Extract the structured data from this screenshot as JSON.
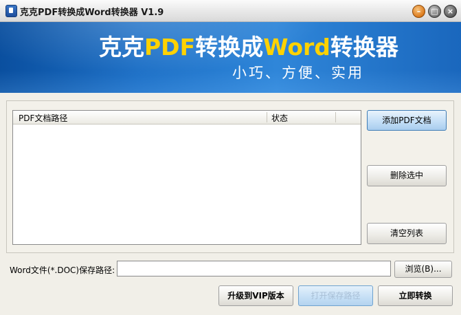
{
  "window": {
    "title": "克克PDF转换成Word转换器 V1.9",
    "controls": {
      "minimize_icon": "minimize-icon",
      "maximize_icon": "maximize-icon",
      "close_icon": "close-icon"
    }
  },
  "banner": {
    "title_part1": "克克",
    "title_part2": "PDF",
    "title_part3": "转换成",
    "title_part4": "Word",
    "title_part5": "转换器",
    "slogan": "小巧、方便、实用",
    "colors": {
      "background": "#1c6fc6",
      "highlight": "#ffd200",
      "text": "#ffffff"
    }
  },
  "filelist": {
    "columns": [
      "PDF文档路径",
      "状态"
    ],
    "rows": []
  },
  "side_buttons": {
    "add": "添加PDF文档",
    "remove": "删除选中",
    "clear": "清空列表"
  },
  "save": {
    "label": "Word文件(*.DOC)保存路径:",
    "value": "",
    "browse": "浏览(B)..."
  },
  "bottom_buttons": {
    "upgrade": "升级到VIP版本",
    "open_folder": "打开保存路径",
    "convert": "立即转换"
  }
}
